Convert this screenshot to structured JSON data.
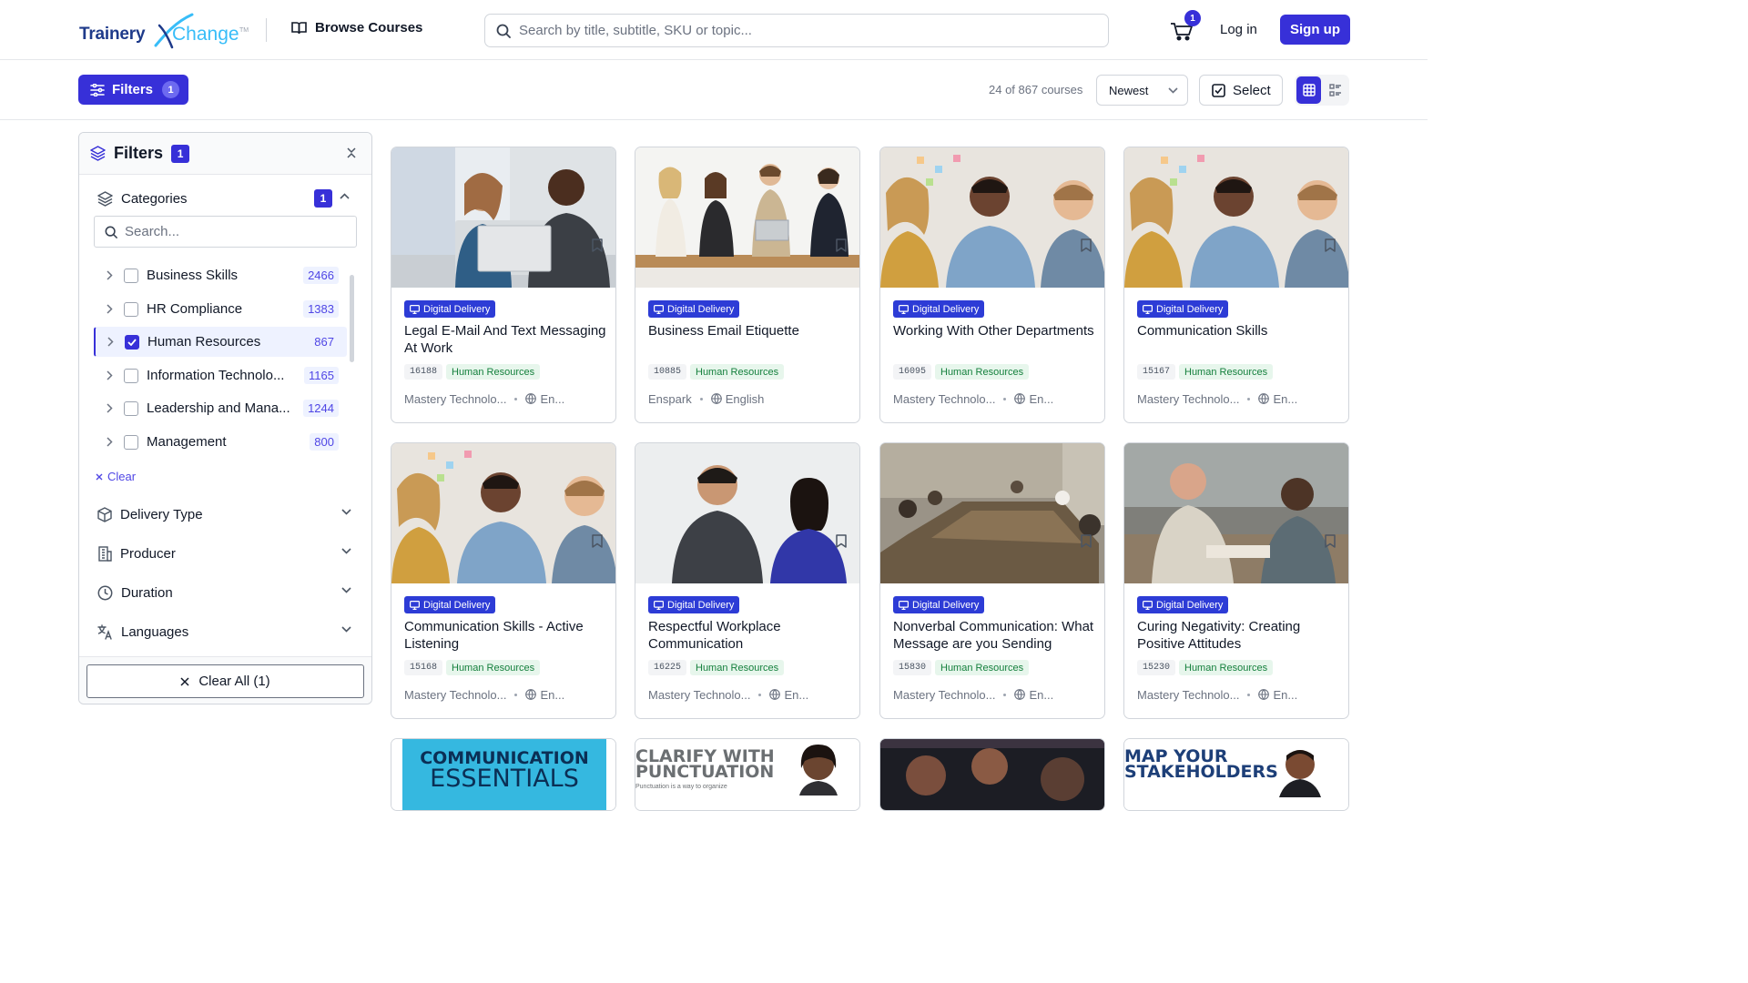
{
  "header": {
    "logo_main": "Trainery",
    "logo_accent": "Change",
    "logo_tm": "TM",
    "browse_label": "Browse Courses",
    "search_placeholder": "Search by title, subtitle, SKU or topic...",
    "cart_count": "1",
    "login_label": "Log in",
    "signup_label": "Sign up"
  },
  "toolbar": {
    "filters_label": "Filters",
    "filters_count": "1",
    "results_text": "24 of 867 courses",
    "sort_value": "Newest",
    "select_label": "Select",
    "view_mode": "grid"
  },
  "sidebar": {
    "title": "Filters",
    "title_count": "1",
    "categories": {
      "label": "Categories",
      "count": "1",
      "search_placeholder": "Search...",
      "items": [
        {
          "label": "Business Skills",
          "count": "2466",
          "checked": false
        },
        {
          "label": "HR Compliance",
          "count": "1383",
          "checked": false
        },
        {
          "label": "Human Resources",
          "count": "867",
          "checked": true
        },
        {
          "label": "Information Technolo...",
          "count": "1165",
          "checked": false
        },
        {
          "label": "Leadership and Mana...",
          "count": "1244",
          "checked": false
        },
        {
          "label": "Management",
          "count": "800",
          "checked": false
        }
      ],
      "clear_label": "Clear"
    },
    "sections": [
      {
        "label": "Delivery Type",
        "icon": "cube-icon"
      },
      {
        "label": "Producer",
        "icon": "building-icon"
      },
      {
        "label": "Duration",
        "icon": "clock-icon"
      },
      {
        "label": "Languages",
        "icon": "translate-icon"
      }
    ],
    "clear_all_label": "Clear All (1)"
  },
  "courses": [
    {
      "badge": "Digital Delivery",
      "title": "Legal E-Mail And Text Messaging At Work",
      "sku": "16188",
      "category": "Human Resources",
      "producer": "Mastery Technolo...",
      "language": "En..."
    },
    {
      "badge": "Digital Delivery",
      "title": "Business Email Etiquette",
      "sku": "10885",
      "category": "Human Resources",
      "producer": "Enspark",
      "language": "English"
    },
    {
      "badge": "Digital Delivery",
      "title": "Working With Other Departments",
      "sku": "16095",
      "category": "Human Resources",
      "producer": "Mastery Technolo...",
      "language": "En..."
    },
    {
      "badge": "Digital Delivery",
      "title": "Communication Skills",
      "sku": "15167",
      "category": "Human Resources",
      "producer": "Mastery Technolo...",
      "language": "En..."
    },
    {
      "badge": "Digital Delivery",
      "title": "Communication Skills - Active Listening",
      "sku": "15168",
      "category": "Human Resources",
      "producer": "Mastery Technolo...",
      "language": "En..."
    },
    {
      "badge": "Digital Delivery",
      "title": "Respectful Workplace Communication",
      "sku": "16225",
      "category": "Human Resources",
      "producer": "Mastery Technolo...",
      "language": "En..."
    },
    {
      "badge": "Digital Delivery",
      "title": "Nonverbal Communication: What Message are you Sending",
      "sku": "15830",
      "category": "Human Resources",
      "producer": "Mastery Technolo...",
      "language": "En..."
    },
    {
      "badge": "Digital Delivery",
      "title": "Curing Negativity: Creating Positive Attitudes",
      "sku": "15230",
      "category": "Human Resources",
      "producer": "Mastery Technolo...",
      "language": "En..."
    }
  ],
  "partial_thumbnails": [
    {
      "line1": "COMMUNICATION",
      "line2": "ESSENTIALS"
    },
    {
      "line1": "CLARIFY WITH",
      "line2": "PUNCTUATION",
      "line3": "Punctuation is a way to organize"
    },
    {
      "line1": "",
      "line2": ""
    },
    {
      "line1": "MAP YOUR",
      "line2": "STAKEHOLDERS"
    }
  ],
  "colors": {
    "accent": "#3730d8",
    "badge": "#2d3cd6",
    "tag_green": "#15803d"
  }
}
